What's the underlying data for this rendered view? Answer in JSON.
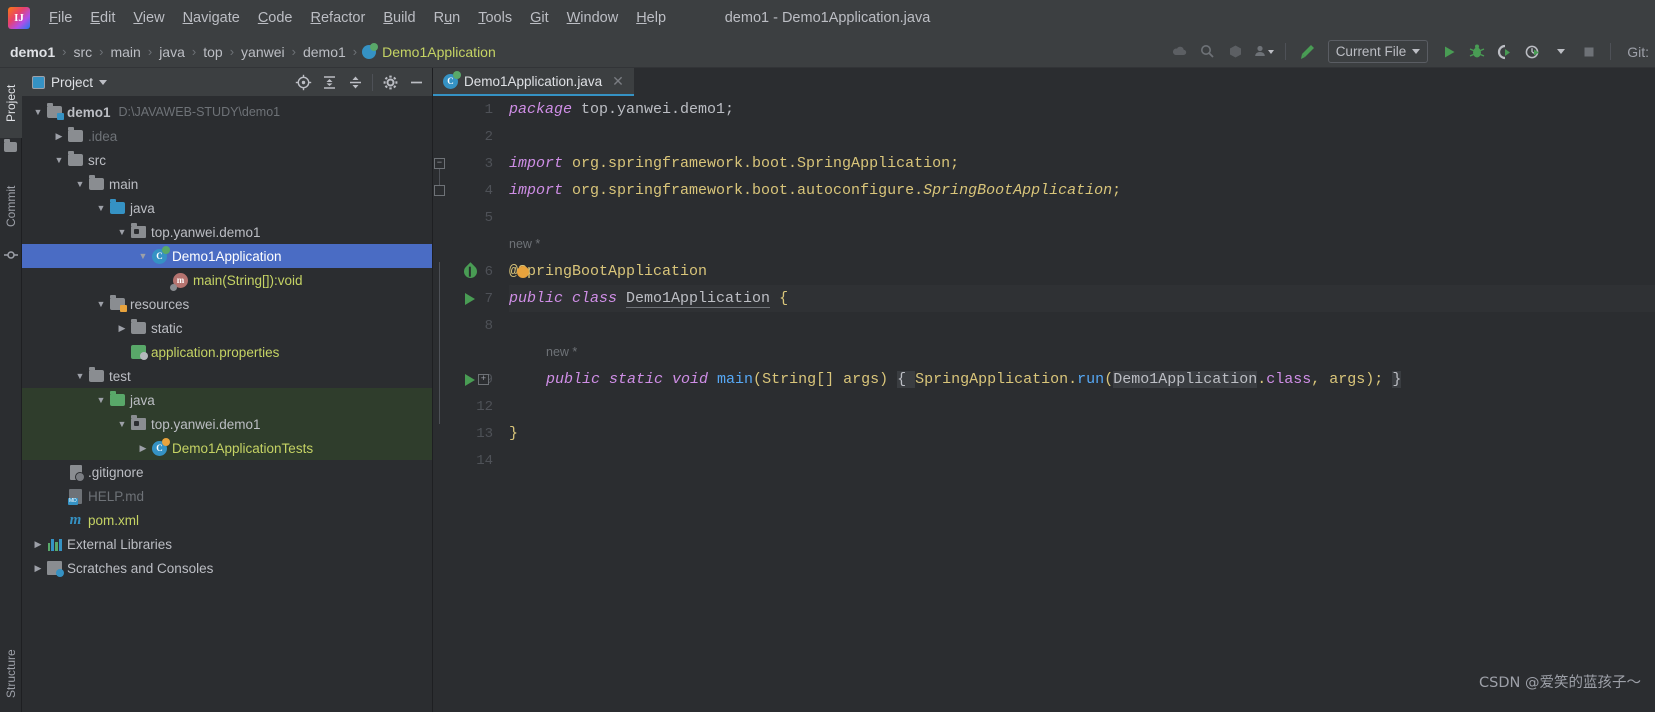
{
  "window": {
    "title": "demo1 - Demo1Application.java"
  },
  "menubar": {
    "logo": "ij-logo",
    "items": [
      {
        "label": "File",
        "mnemonic": "F"
      },
      {
        "label": "Edit",
        "mnemonic": "E"
      },
      {
        "label": "View",
        "mnemonic": "V"
      },
      {
        "label": "Navigate",
        "mnemonic": "N"
      },
      {
        "label": "Code",
        "mnemonic": "C"
      },
      {
        "label": "Refactor",
        "mnemonic": "R"
      },
      {
        "label": "Build",
        "mnemonic": "B"
      },
      {
        "label": "Run",
        "mnemonic": "u"
      },
      {
        "label": "Tools",
        "mnemonic": "T"
      },
      {
        "label": "Git",
        "mnemonic": "G"
      },
      {
        "label": "Window",
        "mnemonic": "W"
      },
      {
        "label": "Help",
        "mnemonic": "H"
      }
    ]
  },
  "navbar": {
    "breadcrumbs": [
      {
        "label": "demo1",
        "type": "module"
      },
      {
        "label": "src",
        "type": "folder"
      },
      {
        "label": "main",
        "type": "folder"
      },
      {
        "label": "java",
        "type": "folder"
      },
      {
        "label": "top",
        "type": "folder"
      },
      {
        "label": "yanwei",
        "type": "folder"
      },
      {
        "label": "demo1",
        "type": "folder"
      },
      {
        "label": "Demo1Application",
        "type": "class"
      }
    ],
    "separator": "›",
    "icons": [
      "cloud-icon",
      "search-everywhere-icon",
      "package-icon",
      "account-icon"
    ],
    "build_icon": "hammer-icon",
    "run_config": {
      "label": "Current File",
      "dropdown_icon": "chevron-down-icon"
    },
    "run_icon": "run-icon",
    "debug_icon": "debug-icon",
    "run_with_coverage_icon": "run-coverage-icon",
    "profiler_icon": "profiler-icon",
    "stop_icon": "stop-icon",
    "git_label": "Git:"
  },
  "left_strip": {
    "tabs": [
      {
        "label": "Project",
        "selected": true,
        "icon": "folder-icon"
      },
      {
        "label": "Commit",
        "selected": false,
        "icon": "commit-icon"
      },
      {
        "label": "Structure",
        "selected": false,
        "icon": "structure-icon"
      }
    ]
  },
  "project_panel": {
    "title": "Project",
    "dropdown_icon": "chevron-down-icon",
    "tools": [
      "select-opened-file-icon",
      "expand-all-icon",
      "collapse-all-icon",
      "settings-gear-icon",
      "hide-icon"
    ],
    "tree": [
      {
        "depth": 0,
        "chevron": "down",
        "icon": "module-folder",
        "label": "demo1",
        "bold": true,
        "sub": "D:\\JAVAWEB-STUDY\\demo1"
      },
      {
        "depth": 1,
        "chevron": "right",
        "icon": "folder",
        "label": ".idea",
        "dim": true
      },
      {
        "depth": 1,
        "chevron": "down",
        "icon": "folder",
        "label": "src"
      },
      {
        "depth": 2,
        "chevron": "down",
        "icon": "folder",
        "label": "main"
      },
      {
        "depth": 3,
        "chevron": "down",
        "icon": "folder-source",
        "label": "java"
      },
      {
        "depth": 4,
        "chevron": "down",
        "icon": "package",
        "label": "top.yanwei.demo1"
      },
      {
        "depth": 5,
        "chevron": "down",
        "icon": "java-class",
        "label": "Demo1Application",
        "selected": true
      },
      {
        "depth": 6,
        "chevron": "none",
        "icon": "method",
        "label": "main(String[]):void",
        "yellow": true
      },
      {
        "depth": 3,
        "chevron": "down",
        "icon": "folder-resources",
        "label": "resources"
      },
      {
        "depth": 4,
        "chevron": "right",
        "icon": "folder",
        "label": "static"
      },
      {
        "depth": 4,
        "chevron": "none",
        "icon": "properties",
        "label": "application.properties",
        "yellow": true
      },
      {
        "depth": 2,
        "chevron": "down",
        "icon": "folder",
        "label": "test"
      },
      {
        "depth": 3,
        "chevron": "down",
        "icon": "folder-test",
        "label": "java",
        "testscope": true
      },
      {
        "depth": 4,
        "chevron": "down",
        "icon": "package",
        "label": "top.yanwei.demo1",
        "testscope": true
      },
      {
        "depth": 5,
        "chevron": "right",
        "icon": "java-test",
        "label": "Demo1ApplicationTests",
        "yellow": true,
        "testscope": true
      },
      {
        "depth": 1,
        "chevron": "none",
        "icon": "gitignore",
        "label": ".gitignore"
      },
      {
        "depth": 1,
        "chevron": "none",
        "icon": "markdown",
        "label": "HELP.md",
        "dim": true
      },
      {
        "depth": 1,
        "chevron": "none",
        "icon": "maven",
        "label": "pom.xml",
        "yellow": true
      },
      {
        "depth": 0,
        "chevron": "right",
        "icon": "libraries",
        "label": "External Libraries"
      },
      {
        "depth": 0,
        "chevron": "right",
        "icon": "scratches",
        "label": "Scratches and Consoles"
      }
    ]
  },
  "editor": {
    "tabs": [
      {
        "label": "Demo1Application.java",
        "icon": "java-class-icon",
        "close_icon": "close-icon",
        "active": true
      }
    ],
    "lines": [
      {
        "num": "1",
        "gutter": "",
        "tokens": [
          {
            "t": "package ",
            "c": "k"
          },
          {
            "t": "top.yanwei.demo1;",
            "c": "id"
          }
        ]
      },
      {
        "num": "2",
        "gutter": "",
        "tokens": []
      },
      {
        "num": "3",
        "gutter": "",
        "fold": "start",
        "tokens": [
          {
            "t": "import ",
            "c": "k"
          },
          {
            "t": "org.springframework.boot.SpringApplication;",
            "c": "t"
          }
        ]
      },
      {
        "num": "4",
        "gutter": "",
        "fold": "end",
        "tokens": [
          {
            "t": "import ",
            "c": "k"
          },
          {
            "t": "org.springframework.boot.autoconfigure.",
            "c": "t"
          },
          {
            "t": "SpringBootApplication",
            "c": "itl"
          },
          {
            "t": ";",
            "c": "t"
          }
        ]
      },
      {
        "num": "5",
        "gutter": "",
        "tokens": []
      },
      {
        "num": "",
        "gutter": "",
        "hint": "new *"
      },
      {
        "num": "6",
        "gutter": "bean",
        "bulb": true,
        "tokens": [
          {
            "t": "@SpringBootApplication",
            "c": "ann"
          }
        ]
      },
      {
        "num": "7",
        "gutter": "run",
        "current": true,
        "tokens": [
          {
            "t": "public class ",
            "c": "k"
          },
          {
            "t": "Demo1Application",
            "c": "cname"
          },
          {
            "t": " {",
            "c": "p"
          }
        ]
      },
      {
        "num": "8",
        "gutter": "",
        "tokens": []
      },
      {
        "num": "",
        "gutter": "",
        "hint": "new *",
        "indent": 1
      },
      {
        "num": "9",
        "gutter": "run",
        "foldmark": "+",
        "indent": 1,
        "tokens": [
          {
            "t": "public static void ",
            "c": "k"
          },
          {
            "t": "main",
            "c": "fn"
          },
          {
            "t": "(",
            "c": "p"
          },
          {
            "t": "String",
            "c": "t"
          },
          {
            "t": "[] ",
            "c": "p"
          },
          {
            "t": "args",
            "c": "t"
          },
          {
            "t": ") ",
            "c": "p"
          },
          {
            "t": "{ ",
            "c": "hl"
          },
          {
            "t": "SpringApplication.",
            "c": "t"
          },
          {
            "t": "run",
            "c": "fn"
          },
          {
            "t": "(",
            "c": "p"
          },
          {
            "t": "Demo1Application",
            "c": "hl"
          },
          {
            "t": ".",
            "c": "p"
          },
          {
            "t": "class",
            "c": "kw"
          },
          {
            "t": ", ",
            "c": "p"
          },
          {
            "t": "args",
            "c": "t"
          },
          {
            "t": "); ",
            "c": "p"
          },
          {
            "t": "}",
            "c": "hl"
          }
        ]
      },
      {
        "num": "12",
        "gutter": "",
        "tokens": []
      },
      {
        "num": "13",
        "gutter": "",
        "tokens": [
          {
            "t": "}",
            "c": "p"
          }
        ]
      },
      {
        "num": "14",
        "gutter": "",
        "tokens": []
      }
    ]
  },
  "watermark": {
    "text": "CSDN @爱笑的蓝孩子～"
  },
  "colors": {
    "selection": "#4a6cc4",
    "test_scope": "#2f3d2c",
    "accent_blue": "#3592c4",
    "run_green": "#499c54",
    "string_yellow": "#c5d364",
    "keyword_purple": "#cf8ee6",
    "background": "#2b2d30",
    "panel": "#3c3f41"
  }
}
